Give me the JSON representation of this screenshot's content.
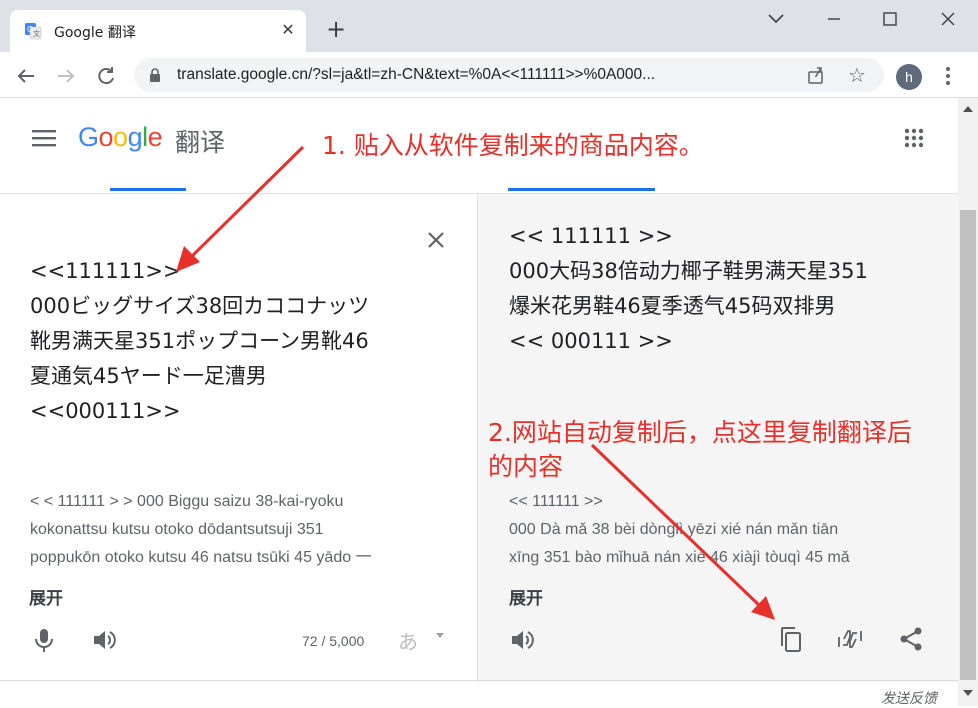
{
  "browser": {
    "tab_title": "Google 翻译",
    "url": "translate.google.cn/?sl=ja&tl=zh-CN&text=%0A<<111111>>%0A000...",
    "avatar_letter": "h"
  },
  "header": {
    "logo": "Google",
    "logo_suffix": "翻译"
  },
  "annotations": {
    "step1": "1. 贴入从软件复制来的商品内容。",
    "step2_line1": "2.网站自动复制后，点这里复制翻译后",
    "step2_line2": "的内容",
    "color": "#e8302a"
  },
  "source": {
    "lines": [
      "<<111111>>",
      "000ビッグサイズ38回カココナッツ",
      "靴男满天星351ポップコーン男靴46",
      "夏通気45ヤード一足漕男",
      "<<000111>>"
    ],
    "romanization": [
      "< < 111111 > > 000 Biggu saizu 38-kai-ryoku",
      "kokonattsu kutsu otoko dōdantsutsuji 351",
      "poppukōn otoko kutsu 46 natsu tsūki 45 yādo 一"
    ],
    "expand_label": "展开",
    "char_count": "72 / 5,000",
    "ime_label": "あ"
  },
  "target": {
    "lines": [
      "<< 111111 >>",
      "000大码38倍动力椰子鞋男满天星351",
      "爆米花男鞋46夏季透气45码双排男",
      "<< 000111 >>"
    ],
    "romanization": [
      "<< 111111 >>",
      "000 Dà mǎ 38 bèi dònglì yēzi xié nán mǎn tiān",
      "xīng 351 bào mǐhuā nán xié 46 xiàjì tòuqì 45 mǎ"
    ],
    "expand_label": "展开"
  },
  "footer": {
    "feedback": "发送反馈"
  }
}
